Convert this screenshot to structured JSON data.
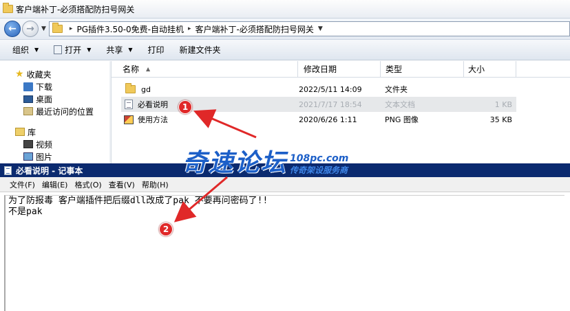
{
  "explorer": {
    "title": "客户端补丁-必须搭配防扫号网关",
    "breadcrumb": [
      "PG插件3.50-0免费-自动挂机",
      "客户端补丁-必须搭配防扫号网关"
    ],
    "toolbar": {
      "organize": "组织",
      "open": "打开",
      "share": "共享",
      "print": "打印",
      "new_folder": "新建文件夹"
    },
    "nav": {
      "favorites": "收藏夹",
      "downloads": "下载",
      "desktop": "桌面",
      "recent": "最近访问的位置",
      "libraries": "库",
      "videos": "视频",
      "pictures": "图片"
    },
    "columns": {
      "name": "名称",
      "date": "修改日期",
      "type": "类型",
      "size": "大小"
    },
    "files": [
      {
        "name": "gd",
        "date": "2022/5/11 14:09",
        "type": "文件夹",
        "size": "",
        "icon": "folder-icon"
      },
      {
        "name": "必看说明",
        "date": "2021/7/17 18:54",
        "type": "文本文档",
        "size": "1 KB",
        "icon": "text-file-icon",
        "selected": true
      },
      {
        "name": "使用方法",
        "date": "2020/6/26 1:11",
        "type": "PNG 图像",
        "size": "35 KB",
        "icon": "png-file-icon"
      }
    ]
  },
  "notepad": {
    "title": "必看说明 - 记事本",
    "menu": {
      "file": "文件(F)",
      "edit": "编辑(E)",
      "format": "格式(O)",
      "view": "查看(V)",
      "help": "帮助(H)"
    },
    "line1": "为了防报毒 客户端插件把后缀dll改成了pak 不要再问密码了!!",
    "line2": "不是pak"
  },
  "watermark": {
    "main": "奇速论坛",
    "site": "108pc.com",
    "slogan": "传奇架设服务商"
  },
  "annotations": {
    "badge1": "1",
    "badge2": "2",
    "color": "#e02828"
  }
}
